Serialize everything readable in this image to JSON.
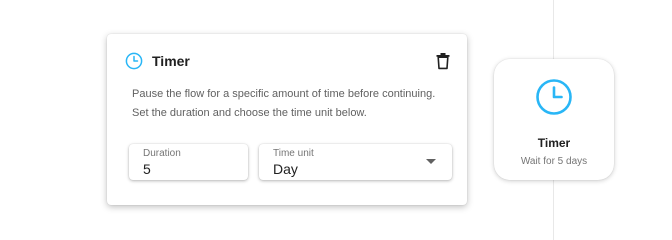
{
  "colors": {
    "accent": "#29b6f6",
    "text_primary": "#212121",
    "text_secondary": "#616161"
  },
  "panel": {
    "icon": "clock-icon",
    "title": "Timer",
    "delete_icon": "trash-icon",
    "description": "Pause the flow for a specific amount of time before continuing. Set the duration and choose the time unit below.",
    "duration": {
      "label": "Duration",
      "value": "5"
    },
    "time_unit": {
      "label": "Time unit",
      "selected": "Day",
      "icon": "chevron-down-icon"
    }
  },
  "node": {
    "icon": "clock-icon",
    "title": "Timer",
    "subtitle": "Wait for 5 days"
  }
}
